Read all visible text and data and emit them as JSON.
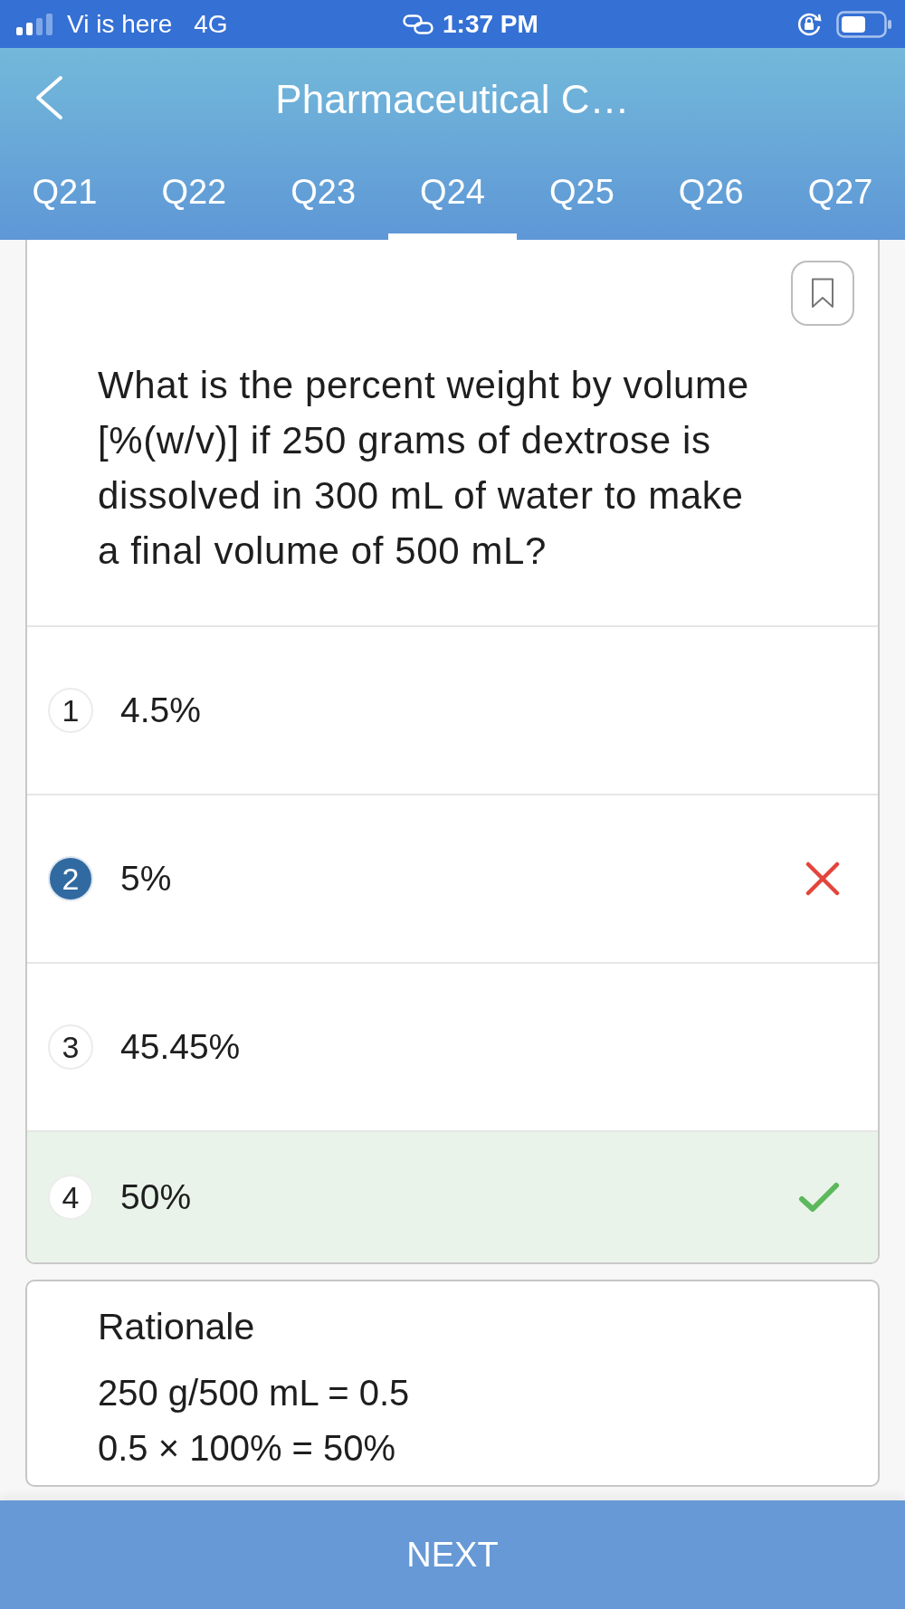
{
  "status_bar": {
    "carrier": "Vi is here",
    "network": "4G",
    "time": "1:37 PM"
  },
  "header": {
    "title": "Pharmaceutical C…"
  },
  "tabs": [
    {
      "label": "Q21",
      "selected": false
    },
    {
      "label": "Q22",
      "selected": false
    },
    {
      "label": "Q23",
      "selected": false
    },
    {
      "label": "Q24",
      "selected": true
    },
    {
      "label": "Q25",
      "selected": false
    },
    {
      "label": "Q26",
      "selected": false
    },
    {
      "label": "Q27",
      "selected": false
    }
  ],
  "question": {
    "bookmarked": false,
    "text": "What is the percent weight by volume [%(w/v)] if 250 grams of dextrose is dissolved in 300 mL of water to make a final volume of 500 mL?"
  },
  "options": [
    {
      "number": "1",
      "text": "4.5%",
      "selected": false,
      "correct": false
    },
    {
      "number": "2",
      "text": "5%",
      "selected": true,
      "correct": false
    },
    {
      "number": "3",
      "text": "45.45%",
      "selected": false,
      "correct": false
    },
    {
      "number": "4",
      "text": "50%",
      "selected": false,
      "correct": true
    }
  ],
  "rationale": {
    "title": "Rationale",
    "lines": [
      "250 g/500 mL = 0.5",
      "0.5 × 100% = 50%"
    ]
  },
  "next_button": {
    "label": "NEXT"
  }
}
